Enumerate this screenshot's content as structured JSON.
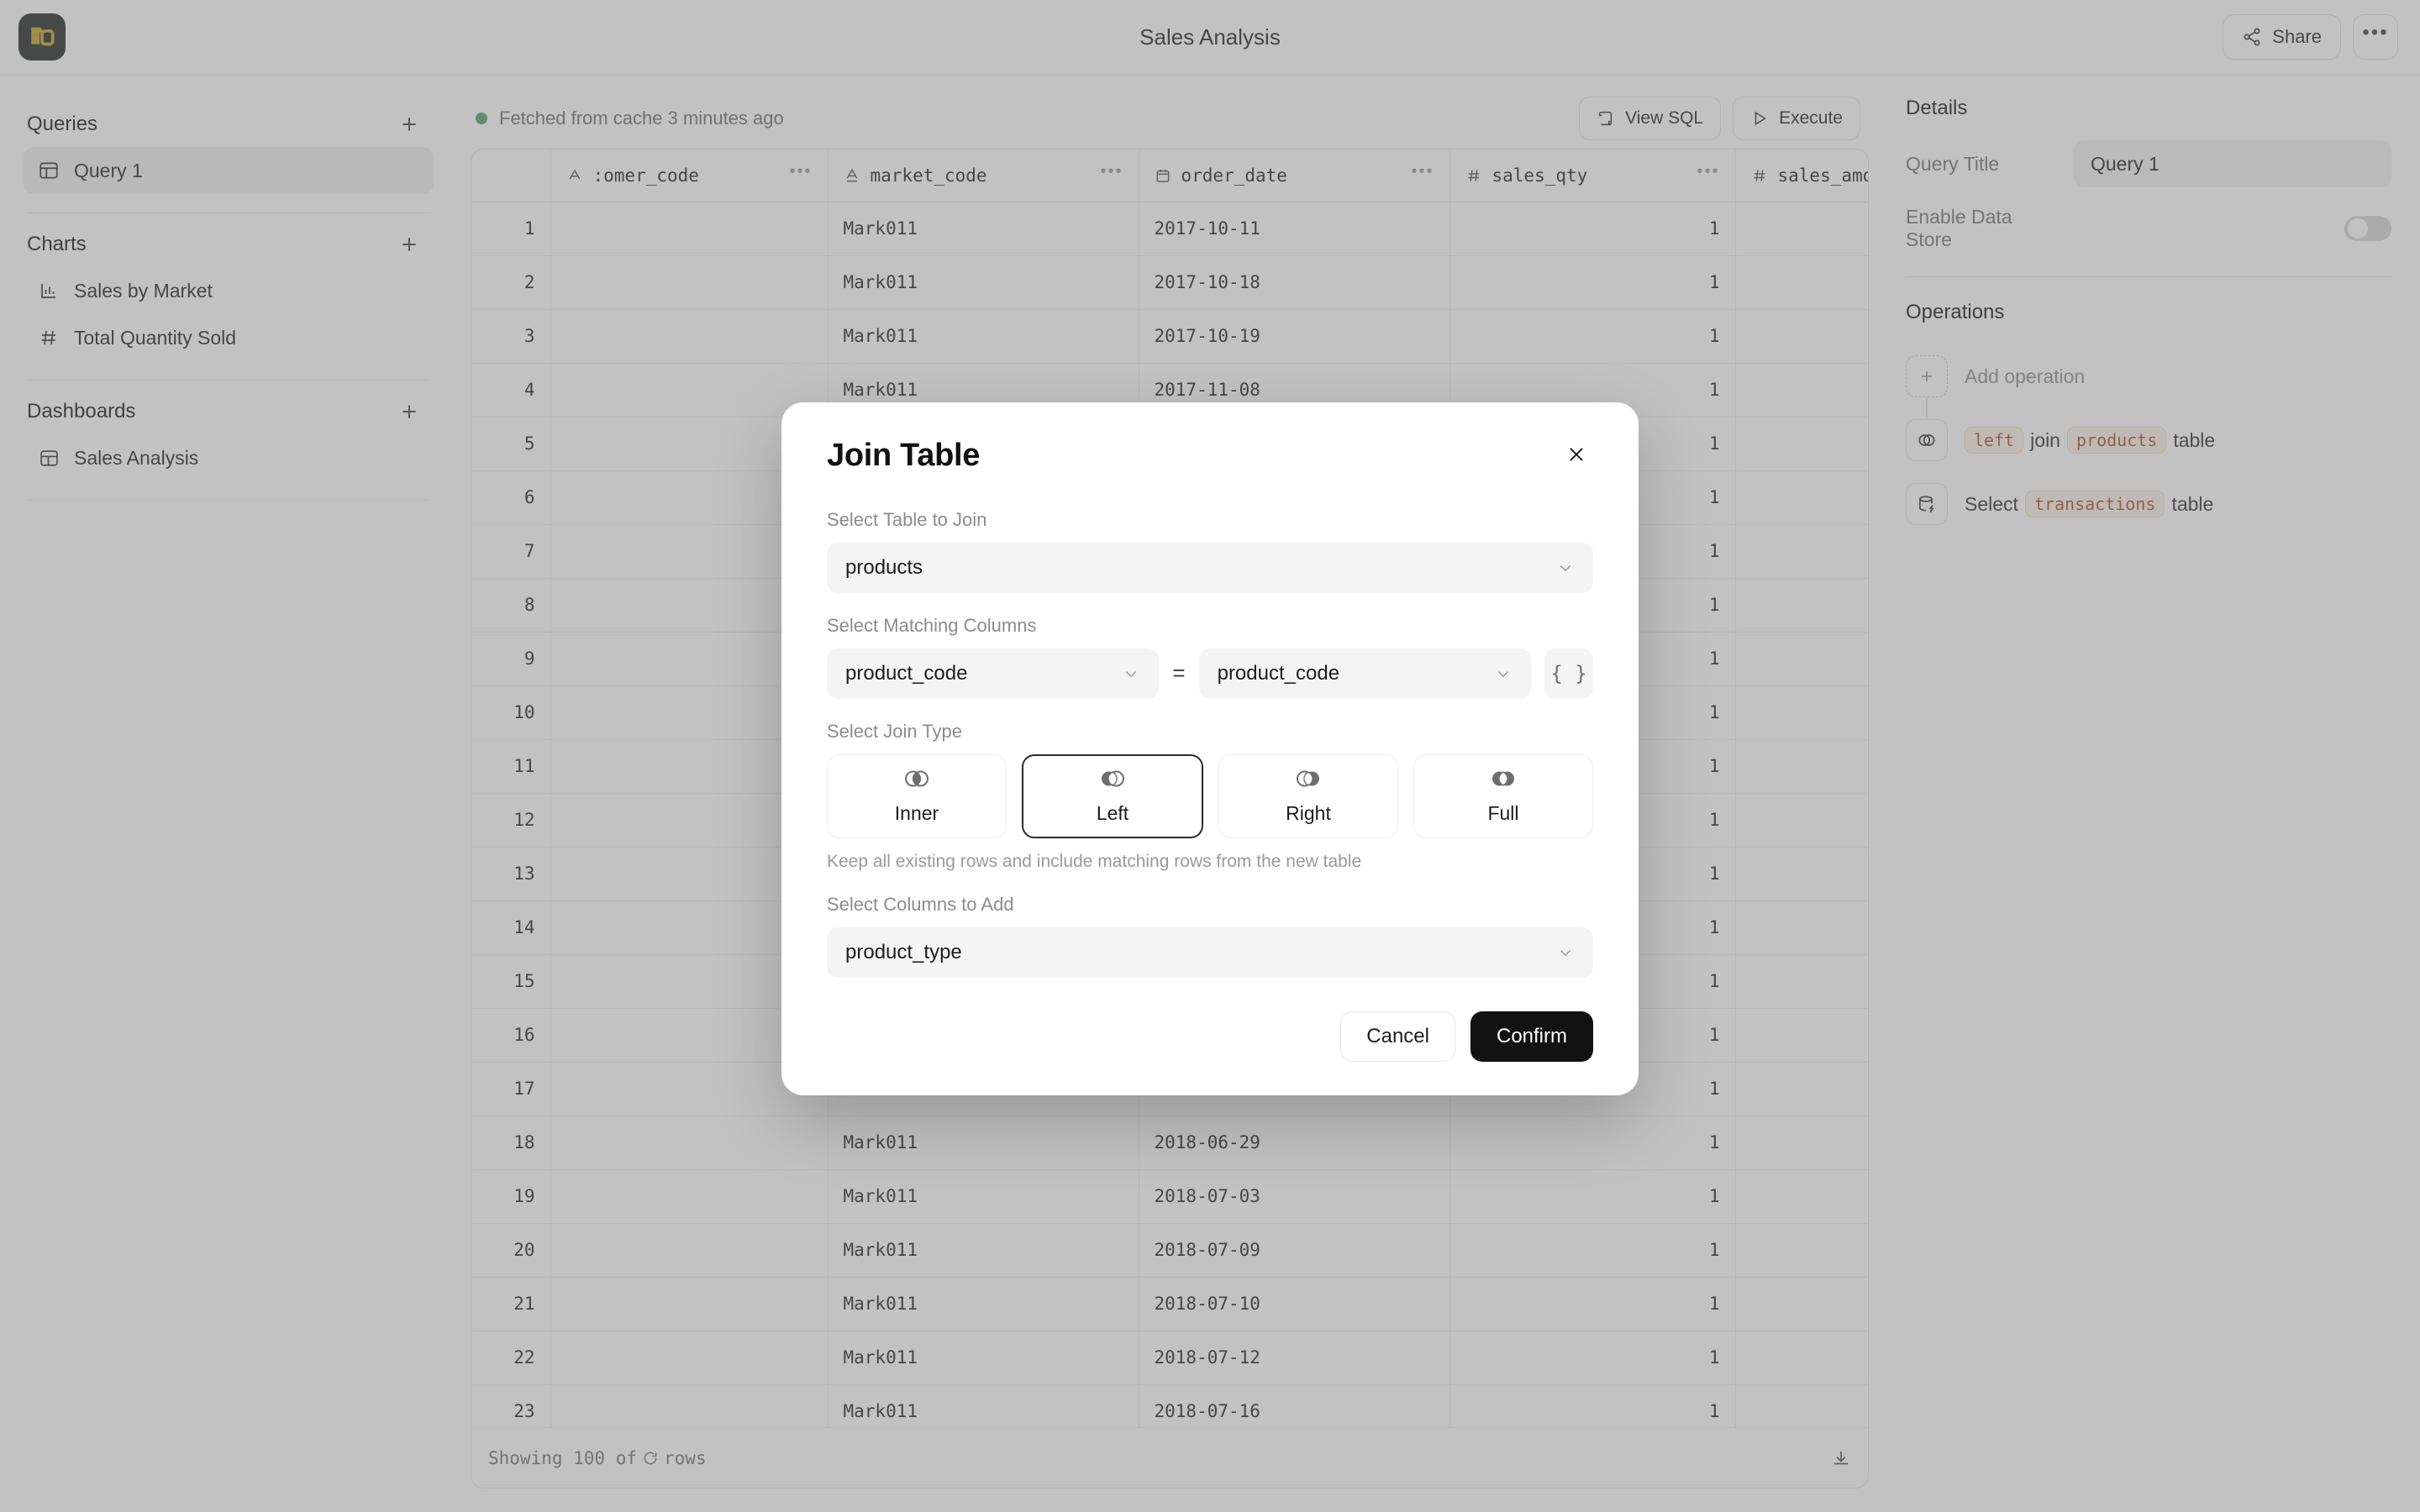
{
  "app": {
    "logo_icon": "database-brand-logo",
    "logo_color": "#c9a227",
    "title": "Sales Analysis"
  },
  "topbar": {
    "share_label": "Share",
    "share_icon": "share-network-icon",
    "more_icon": "ellipsis-horizontal-icon"
  },
  "sidebar": {
    "sections": [
      {
        "title": "Queries",
        "add_icon": "plus-icon",
        "items": [
          {
            "label": "Query 1",
            "icon": "table-icon",
            "active": true
          }
        ]
      },
      {
        "title": "Charts",
        "add_icon": "plus-icon",
        "items": [
          {
            "label": "Sales by Market",
            "icon": "bar-chart-icon",
            "active": false
          },
          {
            "label": "Total Quantity Sold",
            "icon": "hash-icon",
            "active": false
          }
        ]
      },
      {
        "title": "Dashboards",
        "add_icon": "plus-icon",
        "items": [
          {
            "label": "Sales Analysis",
            "icon": "dashboard-icon",
            "active": false
          }
        ]
      }
    ]
  },
  "center": {
    "cache_status": "Fetched from cache 3 minutes ago",
    "status_color": "#4f9d69",
    "view_sql_label": "View SQL",
    "view_sql_icon": "scroll-icon",
    "execute_label": "Execute",
    "execute_icon": "play-icon",
    "footer_prefix": "Showing 100 of",
    "footer_suffix": "rows",
    "footer_spinner_icon": "refresh-spinner-icon",
    "download_icon": "download-icon"
  },
  "table": {
    "columns": [
      {
        "label": "",
        "type_icon": "row-number",
        "key": "idx"
      },
      {
        "label": ":omer_code",
        "type_icon": "text-type-icon",
        "key": "customer_code",
        "menu_icon": "ellipsis-icon"
      },
      {
        "label": "market_code",
        "type_icon": "text-type-icon",
        "key": "market_code",
        "menu_icon": "ellipsis-icon"
      },
      {
        "label": "order_date",
        "type_icon": "calendar-icon",
        "key": "order_date",
        "menu_icon": "ellipsis-icon"
      },
      {
        "label": "sales_qty",
        "type_icon": "hash-icon",
        "key": "sales_qty",
        "menu_icon": "ellipsis-icon"
      },
      {
        "label": "sales_amo",
        "type_icon": "hash-icon",
        "key": "sales_amount",
        "menu_icon": "ellipsis-icon"
      }
    ],
    "rows": [
      {
        "idx": "1",
        "customer_code": "",
        "market_code": "Mark011",
        "order_date": "2017-10-11",
        "sales_qty": "1",
        "sales_amount": ""
      },
      {
        "idx": "2",
        "customer_code": "",
        "market_code": "Mark011",
        "order_date": "2017-10-18",
        "sales_qty": "1",
        "sales_amount": ""
      },
      {
        "idx": "3",
        "customer_code": "",
        "market_code": "Mark011",
        "order_date": "2017-10-19",
        "sales_qty": "1",
        "sales_amount": ""
      },
      {
        "idx": "4",
        "customer_code": "",
        "market_code": "Mark011",
        "order_date": "2017-11-08",
        "sales_qty": "1",
        "sales_amount": ""
      },
      {
        "idx": "5",
        "customer_code": "",
        "market_code": "",
        "order_date": "",
        "sales_qty": "1",
        "sales_amount": ""
      },
      {
        "idx": "6",
        "customer_code": "",
        "market_code": "",
        "order_date": "",
        "sales_qty": "1",
        "sales_amount": ""
      },
      {
        "idx": "7",
        "customer_code": "",
        "market_code": "",
        "order_date": "",
        "sales_qty": "1",
        "sales_amount": ""
      },
      {
        "idx": "8",
        "customer_code": "",
        "market_code": "",
        "order_date": "",
        "sales_qty": "1",
        "sales_amount": ""
      },
      {
        "idx": "9",
        "customer_code": "",
        "market_code": "",
        "order_date": "",
        "sales_qty": "1",
        "sales_amount": ""
      },
      {
        "idx": "10",
        "customer_code": "",
        "market_code": "",
        "order_date": "",
        "sales_qty": "1",
        "sales_amount": ""
      },
      {
        "idx": "11",
        "customer_code": "",
        "market_code": "",
        "order_date": "",
        "sales_qty": "1",
        "sales_amount": ""
      },
      {
        "idx": "12",
        "customer_code": "",
        "market_code": "",
        "order_date": "",
        "sales_qty": "1",
        "sales_amount": ""
      },
      {
        "idx": "13",
        "customer_code": "",
        "market_code": "",
        "order_date": "",
        "sales_qty": "1",
        "sales_amount": ""
      },
      {
        "idx": "14",
        "customer_code": "",
        "market_code": "",
        "order_date": "",
        "sales_qty": "1",
        "sales_amount": ""
      },
      {
        "idx": "15",
        "customer_code": "",
        "market_code": "",
        "order_date": "",
        "sales_qty": "1",
        "sales_amount": ""
      },
      {
        "idx": "16",
        "customer_code": "",
        "market_code": "",
        "order_date": "",
        "sales_qty": "1",
        "sales_amount": ""
      },
      {
        "idx": "17",
        "customer_code": "",
        "market_code": "",
        "order_date": "",
        "sales_qty": "1",
        "sales_amount": ""
      },
      {
        "idx": "18",
        "customer_code": "",
        "market_code": "Mark011",
        "order_date": "2018-06-29",
        "sales_qty": "1",
        "sales_amount": ""
      },
      {
        "idx": "19",
        "customer_code": "",
        "market_code": "Mark011",
        "order_date": "2018-07-03",
        "sales_qty": "1",
        "sales_amount": ""
      },
      {
        "idx": "20",
        "customer_code": "",
        "market_code": "Mark011",
        "order_date": "2018-07-09",
        "sales_qty": "1",
        "sales_amount": ""
      },
      {
        "idx": "21",
        "customer_code": "",
        "market_code": "Mark011",
        "order_date": "2018-07-10",
        "sales_qty": "1",
        "sales_amount": ""
      },
      {
        "idx": "22",
        "customer_code": "",
        "market_code": "Mark011",
        "order_date": "2018-07-12",
        "sales_qty": "1",
        "sales_amount": ""
      },
      {
        "idx": "23",
        "customer_code": "",
        "market_code": "Mark011",
        "order_date": "2018-07-16",
        "sales_qty": "1",
        "sales_amount": ""
      }
    ]
  },
  "details": {
    "title": "Details",
    "query_title_label": "Query Title",
    "query_title_value": "Query 1",
    "data_store_label": "Enable Data Store",
    "data_store_enabled": false
  },
  "operations": {
    "title": "Operations",
    "add_label": "Add operation",
    "add_icon": "plus-icon",
    "items": [
      {
        "icon": "join-venn-icon",
        "parts": [
          {
            "text": "left",
            "chip": true
          },
          {
            "text": "join",
            "chip": false
          },
          {
            "text": "products",
            "chip": true
          },
          {
            "text": "table",
            "chip": false
          }
        ]
      },
      {
        "icon": "database-lightning-icon",
        "parts": [
          {
            "text": "Select",
            "chip": false
          },
          {
            "text": "transactions",
            "chip": true
          },
          {
            "text": "table",
            "chip": false
          }
        ]
      }
    ],
    "chip_color": "#a44a2a"
  },
  "modal": {
    "title": "Join Table",
    "close_icon": "close-icon",
    "table_label": "Select Table to Join",
    "table_value": "products",
    "matching_label": "Select Matching Columns",
    "left_column": "product_code",
    "equals": "=",
    "right_column": "product_code",
    "brace_label": "{ }",
    "join_type_label": "Select Join Type",
    "join_types": [
      {
        "label": "Inner",
        "icon": "venn-inner-icon",
        "selected": false
      },
      {
        "label": "Left",
        "icon": "venn-left-icon",
        "selected": true
      },
      {
        "label": "Right",
        "icon": "venn-right-icon",
        "selected": false
      },
      {
        "label": "Full",
        "icon": "venn-full-icon",
        "selected": false
      }
    ],
    "join_hint": "Keep all existing rows and include matching rows from the new table",
    "columns_label": "Select Columns to Add",
    "columns_value": "product_type",
    "cancel_label": "Cancel",
    "confirm_label": "Confirm"
  }
}
